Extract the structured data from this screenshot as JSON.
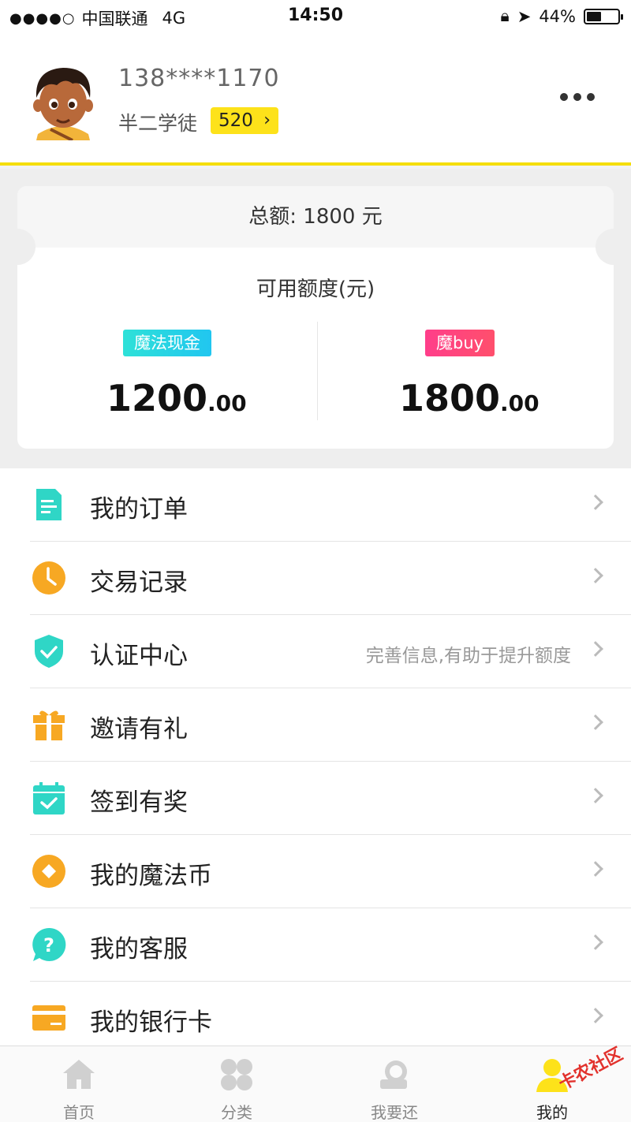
{
  "status_bar": {
    "signal": "●●●●○",
    "carrier": "中国联通",
    "network": "4G",
    "time": "14:50",
    "battery": "44%"
  },
  "profile": {
    "phone": "138****1170",
    "level": "半二学徒",
    "points": "520",
    "avatar_icon": "cartoon-boy-avatar"
  },
  "credit": {
    "total": "总额: 1800 元",
    "available_title": "可用额度(元)",
    "cash": {
      "tag": "魔法现金",
      "amount": "1200",
      "decimals": ".00"
    },
    "buy": {
      "tag": "魔buy",
      "amount": "1800",
      "decimals": ".00"
    }
  },
  "menu": [
    {
      "label": "我的订单",
      "hint": "",
      "icon": "document-icon",
      "color": "#2fd6c6"
    },
    {
      "label": "交易记录",
      "hint": "",
      "icon": "clock-icon",
      "color": "#f7a823"
    },
    {
      "label": "认证中心",
      "hint": "完善信息,有助于提升额度",
      "icon": "shield-check-icon",
      "color": "#2fd6c6"
    },
    {
      "label": "邀请有礼",
      "hint": "",
      "icon": "gift-icon",
      "color": "#f7a823"
    },
    {
      "label": "签到有奖",
      "hint": "",
      "icon": "calendar-check-icon",
      "color": "#2fd6c6"
    },
    {
      "label": "我的魔法币",
      "hint": "",
      "icon": "coin-icon",
      "color": "#f7a823"
    },
    {
      "label": "我的客服",
      "hint": "",
      "icon": "question-bubble-icon",
      "color": "#2fd6c6"
    },
    {
      "label": "我的银行卡",
      "hint": "",
      "icon": "bank-card-icon",
      "color": "#f7a823"
    }
  ],
  "tabs": [
    {
      "label": "首页",
      "icon": "home-icon"
    },
    {
      "label": "分类",
      "icon": "category-icon"
    },
    {
      "label": "我要还",
      "icon": "repay-icon"
    },
    {
      "label": "我的",
      "icon": "user-icon"
    }
  ],
  "watermark": "卡农社区",
  "colors": {
    "accent": "#fde21a",
    "teal": "#2fd6c6",
    "orange": "#f7a823"
  }
}
